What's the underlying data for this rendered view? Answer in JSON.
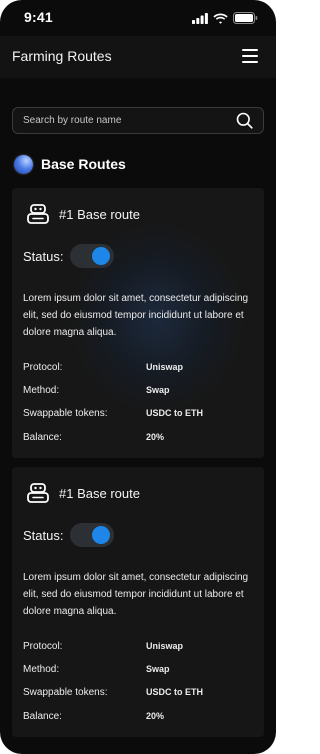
{
  "status_bar": {
    "time": "9:41"
  },
  "header": {
    "title": "Farming Routes"
  },
  "search": {
    "placeholder": "Search by route name"
  },
  "section": {
    "title": "Base Routes"
  },
  "routes": [
    {
      "title": "#1 Base route",
      "status_label": "Status:",
      "status_on": true,
      "description": "Lorem ipsum dolor sit amet, consectetur adipiscing elit, sed do eiusmod tempor incididunt ut labore et dolore magna aliqua.",
      "details": [
        {
          "label": "Protocol:",
          "value": "Uniswap"
        },
        {
          "label": "Method:",
          "value": "Swap"
        },
        {
          "label": "Swappable tokens:",
          "value": "USDC to ETH"
        },
        {
          "label": "Balance:",
          "value": "20%"
        }
      ]
    },
    {
      "title": "#1 Base route",
      "status_label": "Status:",
      "status_on": true,
      "description": "Lorem ipsum dolor sit amet, consectetur adipiscing elit, sed do eiusmod tempor incididunt ut labore et dolore magna aliqua.",
      "details": [
        {
          "label": "Protocol:",
          "value": "Uniswap"
        },
        {
          "label": "Method:",
          "value": "Swap"
        },
        {
          "label": "Swappable tokens:",
          "value": "USDC to ETH"
        },
        {
          "label": "Balance:",
          "value": "20%"
        }
      ]
    }
  ],
  "colors": {
    "background": "#0b0b0b",
    "card": "#171717",
    "accent": "#1e86e8",
    "toggle_track": "#2c2f34"
  },
  "icons": {
    "status": [
      "signal-icon",
      "wifi-icon",
      "battery-icon"
    ],
    "menu": "hamburger-icon",
    "search": "search-icon",
    "section": "globe-icon",
    "card": "robot-icon"
  }
}
